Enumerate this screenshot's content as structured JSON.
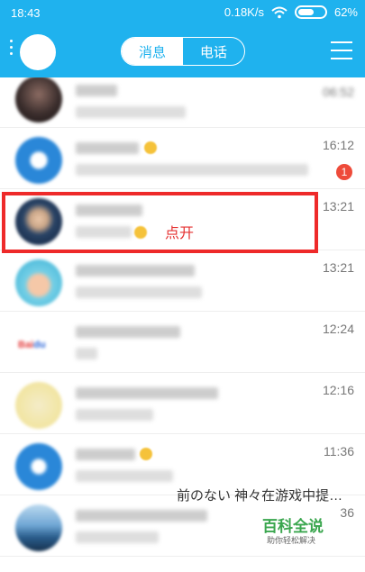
{
  "status_bar": {
    "time": "18:43",
    "network_speed": "0.18K/s",
    "battery_percent": "62%",
    "battery_level": 0.62
  },
  "header": {
    "tab_messages": "消息",
    "tab_calls": "电话",
    "active_tab": "消息"
  },
  "chats": [
    {
      "time": "",
      "unread": ""
    },
    {
      "time": "16:12",
      "unread": "1"
    },
    {
      "time": "13:21",
      "unread": ""
    },
    {
      "time": "13:21",
      "unread": ""
    },
    {
      "time": "12:24",
      "unread": ""
    },
    {
      "time": "12:16",
      "unread": ""
    },
    {
      "time": "11:36",
      "unread": ""
    },
    {
      "time": "36",
      "unread": ""
    }
  ],
  "preview_visible": "前のない 神々在游戏中提…",
  "annotation": "点开",
  "watermark": {
    "title": "百科全说",
    "subtitle": "助你轻松解决"
  },
  "colors": {
    "header": "#1fb2ee",
    "highlight": "#ee2a2a",
    "badge": "#ee4b3a",
    "watermark": "#3aa64e"
  }
}
